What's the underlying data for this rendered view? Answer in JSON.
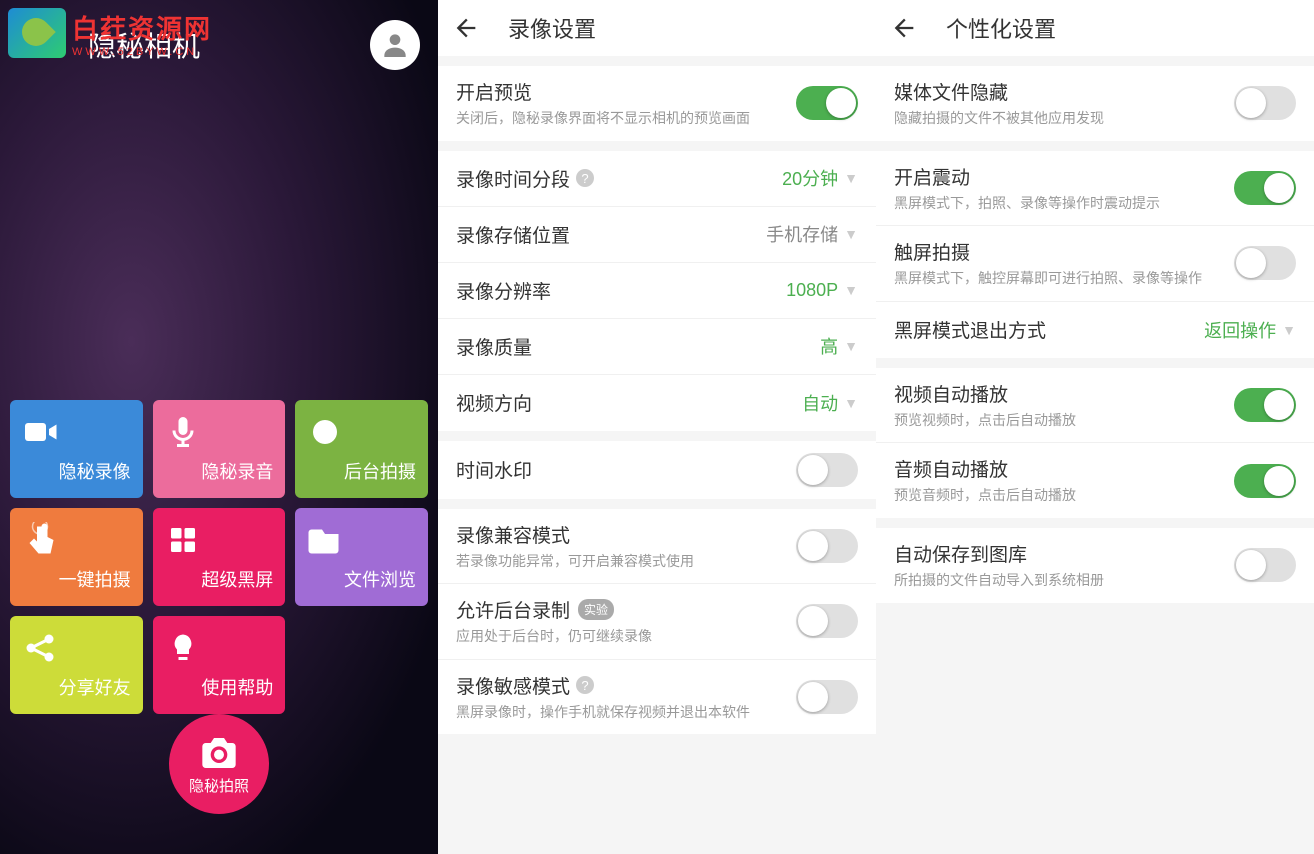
{
  "panel1": {
    "watermark": {
      "main": "白荭资源网",
      "sub": "WWW.52BYW.CN"
    },
    "title": "隐秘相机",
    "tiles": [
      {
        "label": "隐秘录像",
        "color": "#3b8ad9",
        "icon": "video"
      },
      {
        "label": "隐秘录音",
        "color": "#ec6c9c",
        "icon": "mic"
      },
      {
        "label": "后台拍摄",
        "color": "#7cb342",
        "icon": "dot"
      },
      {
        "label": "一键拍摄",
        "color": "#ef7b3e",
        "icon": "touch"
      },
      {
        "label": "超级黑屏",
        "color": "#e91e63",
        "icon": "grid"
      },
      {
        "label": "文件浏览",
        "color": "#a06cd5",
        "icon": "folder"
      },
      {
        "label": "分享好友",
        "color": "#cddc39",
        "icon": "share"
      },
      {
        "label": "使用帮助",
        "color": "#e91e63",
        "icon": "bulb"
      }
    ],
    "capture": "隐秘拍照"
  },
  "panel2": {
    "title": "录像设置",
    "rows": [
      {
        "title": "开启预览",
        "desc": "关闭后，隐秘录像界面将不显示相机的预览画面",
        "type": "toggle",
        "on": true
      },
      {
        "title": "录像时间分段",
        "help": true,
        "type": "select",
        "value": "20分钟",
        "green": true
      },
      {
        "title": "录像存储位置",
        "type": "select",
        "value": "手机存储",
        "green": false
      },
      {
        "title": "录像分辨率",
        "type": "select",
        "value": "1080P",
        "green": true
      },
      {
        "title": "录像质量",
        "type": "select",
        "value": "高",
        "green": true
      },
      {
        "title": "视频方向",
        "type": "select",
        "value": "自动",
        "green": true
      },
      {
        "title": "时间水印",
        "type": "toggle",
        "on": false
      },
      {
        "title": "录像兼容模式",
        "desc": "若录像功能异常，可开启兼容模式使用",
        "type": "toggle",
        "on": false
      },
      {
        "title": "允许后台录制",
        "badge": "实验",
        "desc": "应用处于后台时，仍可继续录像",
        "type": "toggle",
        "on": false
      },
      {
        "title": "录像敏感模式",
        "help": true,
        "desc": "黑屏录像时，操作手机就保存视频并退出本软件",
        "type": "toggle",
        "on": false
      }
    ]
  },
  "panel3": {
    "title": "个性化设置",
    "groups": [
      [
        {
          "title": "媒体文件隐藏",
          "desc": "隐藏拍摄的文件不被其他应用发现",
          "type": "toggle",
          "on": false
        }
      ],
      [
        {
          "title": "开启震动",
          "desc": "黑屏模式下，拍照、录像等操作时震动提示",
          "type": "toggle",
          "on": true
        },
        {
          "title": "触屏拍摄",
          "desc": "黑屏模式下，触控屏幕即可进行拍照、录像等操作",
          "type": "toggle",
          "on": false
        },
        {
          "title": "黑屏模式退出方式",
          "type": "select",
          "value": "返回操作",
          "green": true
        }
      ],
      [
        {
          "title": "视频自动播放",
          "desc": "预览视频时，点击后自动播放",
          "type": "toggle",
          "on": true
        },
        {
          "title": "音频自动播放",
          "desc": "预览音频时，点击后自动播放",
          "type": "toggle",
          "on": true
        }
      ],
      [
        {
          "title": "自动保存到图库",
          "desc": "所拍摄的文件自动导入到系统相册",
          "type": "toggle",
          "on": false
        }
      ]
    ]
  }
}
